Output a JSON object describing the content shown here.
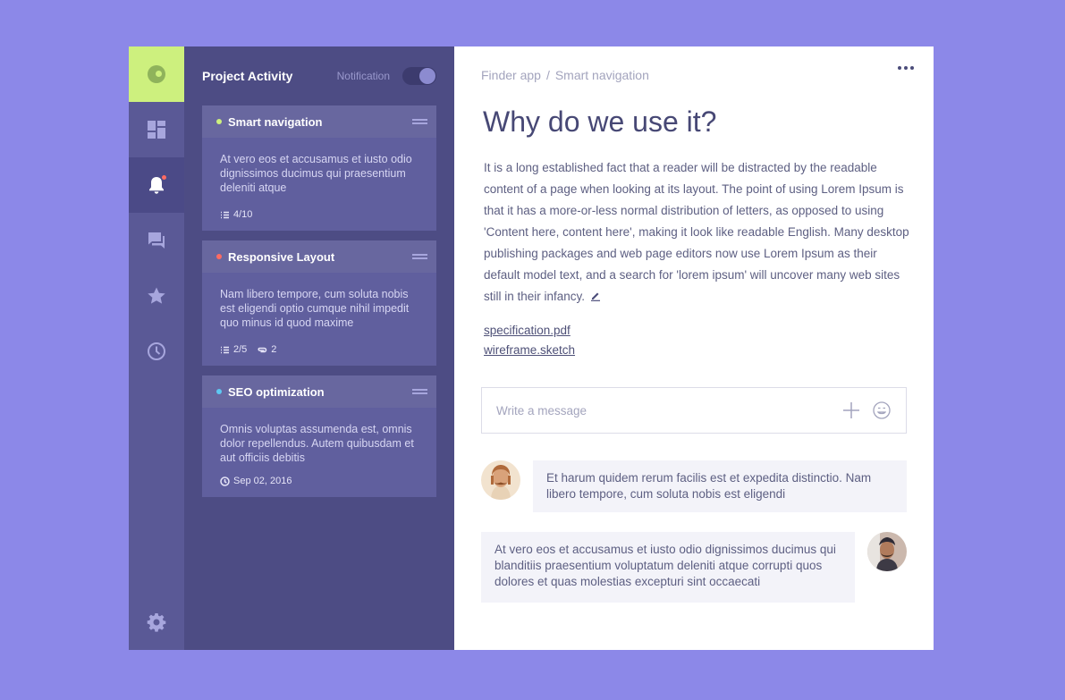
{
  "nav": {
    "items": [
      {
        "name": "dashboard",
        "icon": "dashboard-icon"
      },
      {
        "name": "notifications",
        "icon": "bell-icon",
        "active": true,
        "badge_color": "#ff6b62"
      },
      {
        "name": "messages",
        "icon": "chat-icon"
      },
      {
        "name": "favorites",
        "icon": "star-icon"
      },
      {
        "name": "history",
        "icon": "clock-icon"
      },
      {
        "name": "settings",
        "icon": "gear-icon"
      }
    ],
    "logo_color": "#cdf07e"
  },
  "activity": {
    "title": "Project Activity",
    "notification_label": "Notification",
    "notification_on": true,
    "cards": [
      {
        "title": "Smart navigation",
        "dot_color": "#cdf07e",
        "body": "At vero eos et accusamus et iusto odio dignissimos ducimus qui praesentium deleniti atque",
        "tasks": "4/10"
      },
      {
        "title": "Responsive Layout",
        "dot_color": "#ff6b62",
        "body": "Nam libero tempore, cum soluta nobis est eligendi optio cumque nihil impedit quo minus id quod maxime",
        "tasks": "2/5",
        "attachments": "2"
      },
      {
        "title": "SEO optimization",
        "dot_color": "#5ec8f2",
        "body": "Omnis voluptas assumenda est, omnis dolor repellendus. Autem quibusdam et aut officiis debitis",
        "date": "Sep 02, 2016"
      }
    ]
  },
  "main": {
    "breadcrumb": [
      "Finder app",
      "Smart navigation"
    ],
    "breadcrumb_sep": "/",
    "heading": "Why do we use it?",
    "body": "It is a long established fact that a reader will be distracted by the readable content of a page when looking at its layout. The point of using Lorem Ipsum is that it has a more-or-less normal distribution of letters, as opposed to using 'Content here, content here', making it look like readable English. Many desktop publishing packages and web page editors now use Lorem Ipsum as their default model text, and a search for 'lorem ipsum' will uncover many web sites still in their infancy.",
    "files": [
      "specification.pdf",
      "wireframe.sketch"
    ],
    "composer_placeholder": "Write a message",
    "messages": [
      {
        "from": "other",
        "text": "Et harum quidem rerum facilis est et expedita distinctio. Nam libero tempore, cum soluta nobis est eligendi"
      },
      {
        "from": "me",
        "text": "At vero eos et accusamus et iusto odio dignissimos ducimus qui blanditiis praesentium voluptatum deleniti atque corrupti quos dolores et quas molestias excepturi sint occaecati"
      }
    ]
  }
}
